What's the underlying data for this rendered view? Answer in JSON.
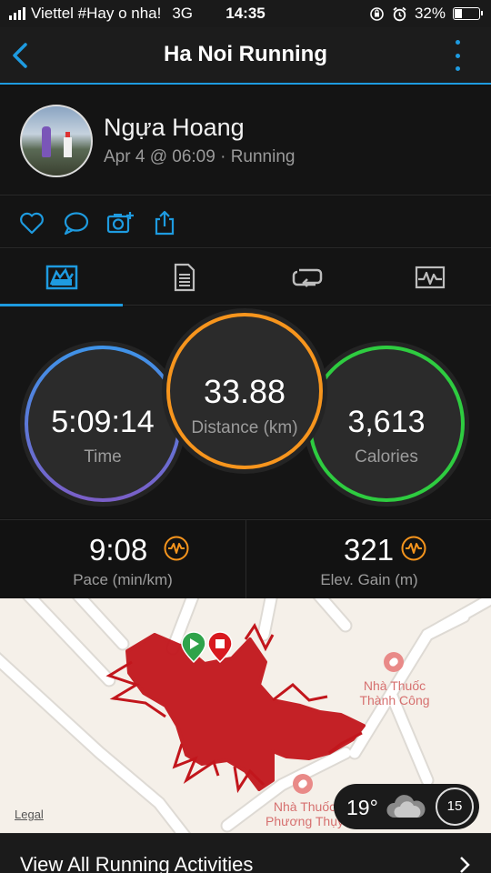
{
  "status_bar": {
    "carrier": "Viettel #Hay o nha!",
    "network": "3G",
    "time": "14:35",
    "battery_percent_label": "32%",
    "battery_level": 0.32
  },
  "header": {
    "title": "Ha Noi Running",
    "back_icon": "chevron-left-icon",
    "menu_icon": "more-vertical-icon"
  },
  "profile": {
    "name": "Ngựa Hoang",
    "meta": "Apr 4 @ 06:09 · Running"
  },
  "actions": [
    "heart-icon",
    "comment-icon",
    "add-photo-icon",
    "share-icon"
  ],
  "tabs": [
    {
      "icon": "stats-icon",
      "active": true
    },
    {
      "icon": "details-icon",
      "active": false
    },
    {
      "icon": "laps-icon",
      "active": false
    },
    {
      "icon": "chart-icon",
      "active": false
    }
  ],
  "rings": {
    "time": {
      "value": "5:09:14",
      "label": "Time"
    },
    "distance": {
      "value": "33.88",
      "label": "Distance (km)"
    },
    "calories": {
      "value": "3,613",
      "label": "Calories"
    }
  },
  "stats": {
    "pace": {
      "value": "9:08",
      "label": "Pace (min/km)"
    },
    "elevation": {
      "value": "321",
      "label": "Elev. Gain (m)"
    }
  },
  "map": {
    "places": [
      {
        "line1": "Nhà Thuốc",
        "line2": "Thành Công"
      },
      {
        "line1": "Nhà Thuốc",
        "line2": "Phương Thụy"
      }
    ],
    "legal": "Legal",
    "weather": {
      "temp": "19°",
      "badge": "15"
    }
  },
  "footer": {
    "view_all": "View All Running Activities"
  },
  "colors": {
    "accent": "#1e9be0",
    "time_ring": "#5a7fd6",
    "distance_ring": "#f7951d",
    "calories_ring": "#2ecc40",
    "route": "#c2161c"
  }
}
